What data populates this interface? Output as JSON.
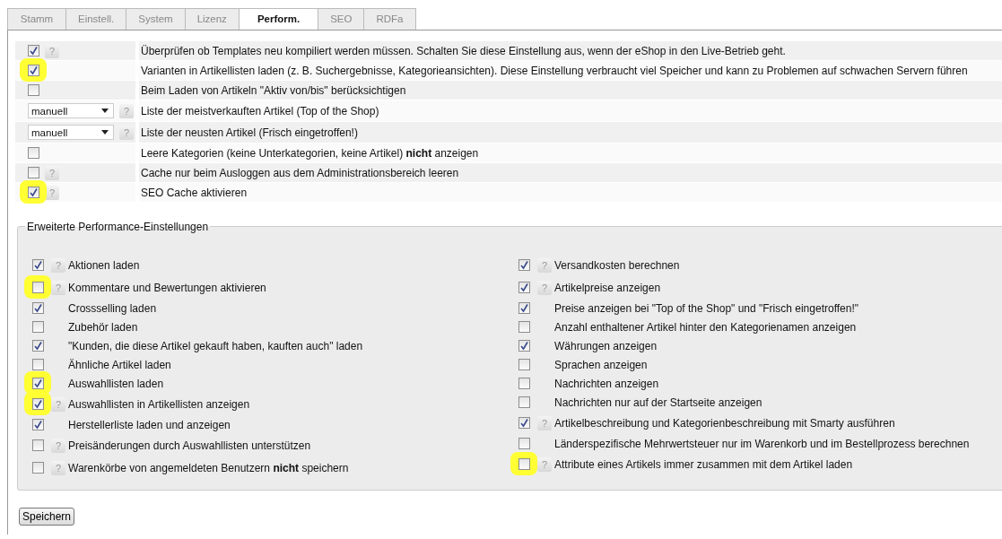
{
  "help_glyph": "?",
  "tabs": [
    {
      "label": "Stamm",
      "selected": false
    },
    {
      "label": "Einstell.",
      "selected": false
    },
    {
      "label": "System",
      "selected": false
    },
    {
      "label": "Lizenz",
      "selected": false
    },
    {
      "label": "Perform.",
      "selected": true
    },
    {
      "label": "SEO",
      "selected": false
    },
    {
      "label": "RDFa",
      "selected": false
    }
  ],
  "settings": [
    {
      "kind": "checkbox",
      "checked": true,
      "help": true,
      "highlighted": false,
      "label": "Überprüfen ob Templates neu kompiliert werden müssen. Schalten Sie diese Einstellung aus, wenn der eShop in den Live-Betrieb geht."
    },
    {
      "kind": "checkbox",
      "checked": true,
      "help": false,
      "highlighted": true,
      "label": "Varianten in Artikellisten laden (z. B. Suchergebnisse, Kategorieansichten). Diese Einstellung verbraucht viel Speicher und kann zu Problemen auf schwachen Servern führen"
    },
    {
      "kind": "checkbox",
      "checked": false,
      "help": false,
      "highlighted": false,
      "label": "Beim Laden von Artikeln \"Aktiv von/bis\" berücksichtigen"
    },
    {
      "kind": "select",
      "value": "manuell",
      "help": true,
      "label": "Liste der meistverkauften Artikel (Top of the Shop)"
    },
    {
      "kind": "select",
      "value": "manuell",
      "help": true,
      "label": "Liste der neusten Artikel (Frisch eingetroffen!)"
    },
    {
      "kind": "checkbox",
      "checked": false,
      "help": false,
      "highlighted": false,
      "label": "Leere Kategorien (keine Unterkategorien, keine Artikel) **nicht** anzeigen"
    },
    {
      "kind": "checkbox",
      "checked": false,
      "help": true,
      "highlighted": false,
      "label": "Cache nur beim Ausloggen aus dem Administrationsbereich leeren"
    },
    {
      "kind": "checkbox",
      "checked": true,
      "help": true,
      "highlighted": true,
      "label": "SEO Cache aktivieren"
    }
  ],
  "advanced": {
    "legend": "Erweiterte Performance-Einstellungen",
    "columns": [
      [
        {
          "checked": true,
          "help": true,
          "highlighted": false,
          "label": "Aktionen laden"
        },
        {
          "checked": false,
          "help": true,
          "highlighted": true,
          "label": "Kommentare und Bewertungen aktivieren"
        },
        {
          "checked": true,
          "help": false,
          "highlighted": false,
          "label": "Crossselling laden"
        },
        {
          "checked": false,
          "help": false,
          "highlighted": false,
          "label": "Zubehör laden"
        },
        {
          "checked": true,
          "help": false,
          "highlighted": false,
          "label": "\"Kunden, die diese Artikel gekauft haben, kauften auch\" laden"
        },
        {
          "checked": false,
          "help": false,
          "highlighted": false,
          "label": "Ähnliche Artikel laden"
        },
        {
          "checked": true,
          "help": false,
          "highlighted": true,
          "label": "Auswahllisten laden"
        },
        {
          "checked": true,
          "help": true,
          "highlighted": true,
          "label": "Auswahllisten in Artikellisten anzeigen"
        },
        {
          "checked": true,
          "help": false,
          "highlighted": false,
          "label": "Herstellerliste laden und anzeigen"
        },
        {
          "checked": false,
          "help": true,
          "highlighted": false,
          "label": "Preisänderungen durch Auswahllisten unterstützen"
        },
        {
          "checked": false,
          "help": true,
          "highlighted": false,
          "label": "Warenkörbe von angemeldeten Benutzern **nicht** speichern"
        }
      ],
      [
        {
          "checked": true,
          "help": true,
          "highlighted": false,
          "label": "Versandkosten berechnen"
        },
        {
          "checked": true,
          "help": true,
          "highlighted": false,
          "label": "Artikelpreise anzeigen"
        },
        {
          "checked": true,
          "help": false,
          "highlighted": false,
          "label": "Preise anzeigen bei \"Top of the Shop\" und \"Frisch eingetroffen!\""
        },
        {
          "checked": false,
          "help": false,
          "highlighted": false,
          "label": "Anzahl enthaltener Artikel hinter den Kategorienamen anzeigen"
        },
        {
          "checked": true,
          "help": false,
          "highlighted": false,
          "label": "Währungen anzeigen"
        },
        {
          "checked": false,
          "help": false,
          "highlighted": false,
          "label": "Sprachen anzeigen"
        },
        {
          "checked": false,
          "help": false,
          "highlighted": false,
          "label": "Nachrichten anzeigen"
        },
        {
          "checked": false,
          "help": false,
          "highlighted": false,
          "label": "Nachrichten nur auf der Startseite anzeigen"
        },
        {
          "checked": true,
          "help": true,
          "highlighted": false,
          "label": "Artikelbeschreibung und Kategorienbeschreibung mit Smarty ausführen"
        },
        {
          "checked": false,
          "help": false,
          "highlighted": false,
          "label": "Länderspezifische Mehrwertsteuer nur im Warenkorb und im Bestellprozess berechnen"
        },
        {
          "checked": false,
          "help": true,
          "highlighted": true,
          "label": "Attribute eines Artikels immer zusammen mit dem Artikel laden"
        }
      ]
    ]
  },
  "save_button": "Speichern"
}
